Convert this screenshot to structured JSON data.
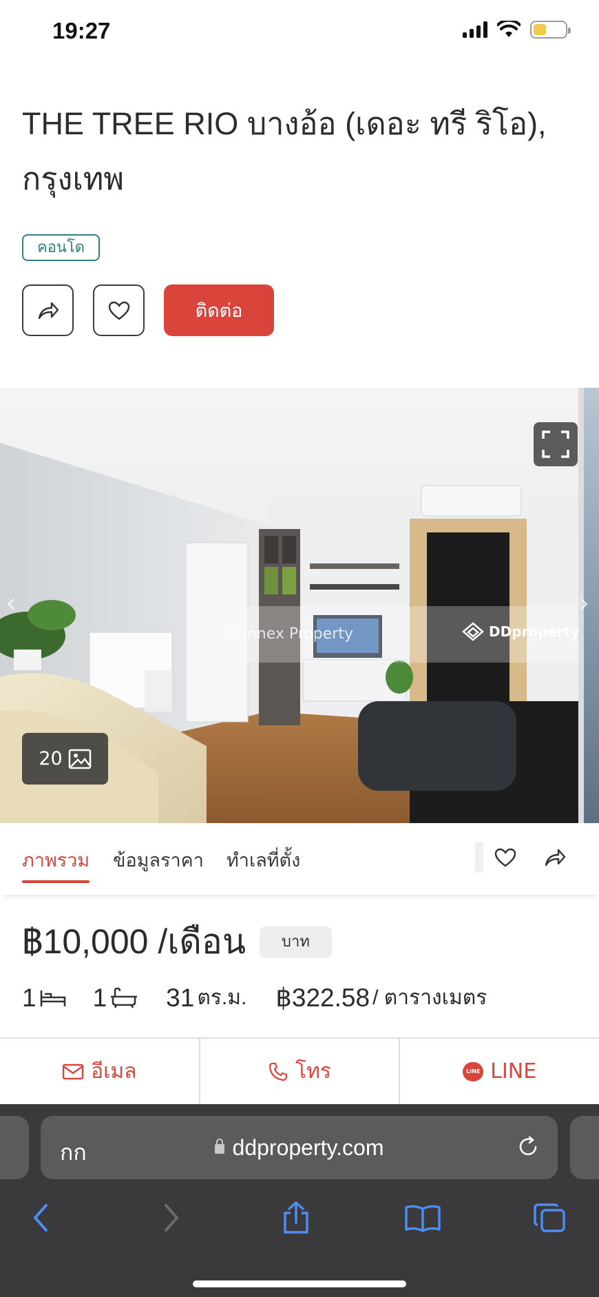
{
  "status_bar": {
    "time": "19:27"
  },
  "listing": {
    "title": "THE TREE RIO บางอ้อ (เดอะ ทรี ริโอ), กรุงเทพ",
    "type": "คอนโด",
    "contact_label": "ติดต่อ"
  },
  "gallery": {
    "photo_count": "20",
    "watermark_left": "Connex Property",
    "watermark_right": "DDproperty"
  },
  "tabs": [
    {
      "label": "ภาพรวม",
      "active": true
    },
    {
      "label": "ข้อมูลราคา",
      "active": false
    },
    {
      "label": "ทำเลที่ตั้ง",
      "active": false
    }
  ],
  "price": {
    "amount": "฿10,000 /เดือน",
    "currency": "บาท"
  },
  "specs": {
    "bedrooms": "1",
    "bathrooms": "1",
    "area": "31",
    "area_unit": "ตร.ม.",
    "price_per_sqm": "฿322.58",
    "price_per_sqm_unit": "/ ตารางเมตร"
  },
  "contact_bar": {
    "email": "อีเมล",
    "phone": "โทร",
    "line": "LINE",
    "line_logo_text": "LINE"
  },
  "browser": {
    "aa": "กก",
    "url": "ddproperty.com"
  },
  "colors": {
    "accent": "#d9453b",
    "badge": "#2f7f86",
    "browser_bg": "#3a3a3c",
    "browser_tint": "#4c8ef7"
  },
  "icons": [
    "signal-icon",
    "wifi-icon",
    "battery-icon",
    "share-icon",
    "heart-icon",
    "expand-icon",
    "gallery-icon",
    "bed-icon",
    "bath-icon",
    "mail-icon",
    "phone-icon",
    "line-icon",
    "lock-icon",
    "reload-icon",
    "back-icon",
    "forward-icon",
    "share-sheet-icon",
    "bookmarks-icon",
    "tabs-icon"
  ]
}
